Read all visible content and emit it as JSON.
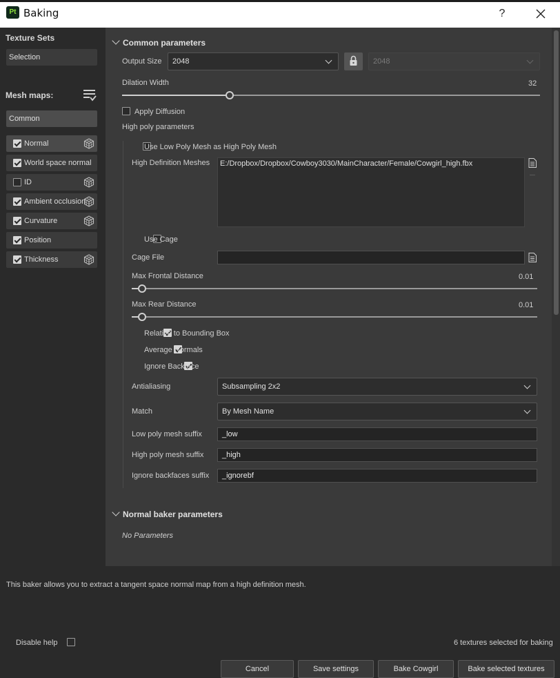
{
  "window": {
    "app_icon": "Pt",
    "title": "Baking",
    "help": "?",
    "close_icon": "close-icon"
  },
  "left": {
    "texture_sets_label": "Texture Sets",
    "selection_label": "Selection",
    "mesh_maps_label": "Mesh maps:",
    "common_label": "Common",
    "maps": [
      {
        "label": "Normal",
        "checked": true,
        "has_cube": true
      },
      {
        "label": "World space normal",
        "checked": true,
        "has_cube": false
      },
      {
        "label": "ID",
        "checked": false,
        "has_cube": true
      },
      {
        "label": "Ambient occlusion",
        "checked": true,
        "has_cube": true
      },
      {
        "label": "Curvature",
        "checked": true,
        "has_cube": true
      },
      {
        "label": "Position",
        "checked": true,
        "has_cube": false
      },
      {
        "label": "Thickness",
        "checked": true,
        "has_cube": true
      }
    ]
  },
  "common": {
    "header": "Common parameters",
    "output_size_label": "Output Size",
    "output_size_value": "2048",
    "output_size_locked_value": "2048",
    "dilation_label": "Dilation Width",
    "dilation_value": "32",
    "dilation_fraction": 0.5,
    "apply_diffusion_label": "Apply Diffusion",
    "high_poly_label": "High poly parameters",
    "use_low_poly_label": "Use Low Poly Mesh as High Poly Mesh",
    "hd_meshes_label": "High Definition Meshes",
    "hd_meshes_value": "E:/Dropbox/Dropbox/Cowboy3030/MainCharacter/Female/Cowgirl_high.fbx",
    "use_cage_label": "Use Cage",
    "cage_file_label": "Cage File",
    "cage_file_value": "",
    "max_frontal_label": "Max Frontal Distance",
    "max_frontal_value": "0.01",
    "max_rear_label": "Max Rear Distance",
    "max_rear_value": "0.01",
    "relative_bbox_label": "Relative to Bounding Box",
    "average_normals_label": "Average Normals",
    "ignore_backface_label": "Ignore Backface",
    "antialiasing_label": "Antialiasing",
    "antialiasing_value": "Subsampling 2x2",
    "match_label": "Match",
    "match_value": "By Mesh Name",
    "low_suffix_label": "Low poly mesh suffix",
    "low_suffix_value": "_low",
    "high_suffix_label": "High poly mesh suffix",
    "high_suffix_value": "_high",
    "ignore_suffix_label": "Ignore backfaces suffix",
    "ignore_suffix_value": "_ignorebf"
  },
  "normal_baker": {
    "header": "Normal baker parameters",
    "no_params": "No Parameters"
  },
  "help_text": "This baker allows you to extract a tangent space normal map from a high definition mesh.",
  "footer": {
    "disable_help_label": "Disable help",
    "status": "6 textures selected for baking",
    "cancel": "Cancel",
    "save_settings": "Save settings",
    "bake_cowgirl": "Bake Cowgirl",
    "bake_selected": "Bake selected textures"
  }
}
